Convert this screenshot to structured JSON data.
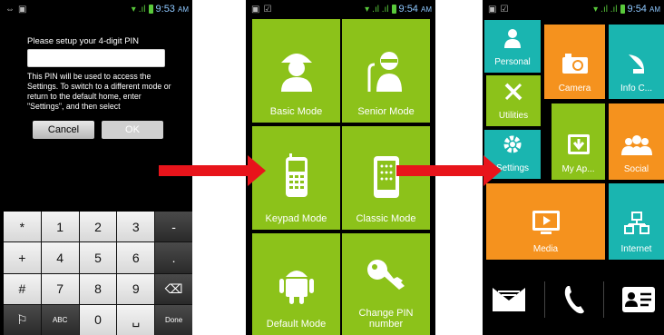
{
  "screen1": {
    "time": "9:53",
    "ampm": "AM",
    "pin_prompt": "Please setup your 4-digit PIN",
    "pin_value": "",
    "pin_description": "This PIN will be used to access the Settings. To switch to a different mode or return to the default home, enter \"Settings\", and then select",
    "cancel_label": "Cancel",
    "ok_label": "OK",
    "keys": [
      "*",
      "1",
      "2",
      "3",
      "-",
      "+",
      "4",
      "5",
      "6",
      ".",
      "#",
      "7",
      "8",
      "9",
      "⌫",
      "⚐",
      "ABC",
      "0",
      "␣",
      "Done"
    ]
  },
  "screen2": {
    "time": "9:54",
    "ampm": "AM",
    "tiles": [
      "Basic Mode",
      "Senior Mode",
      "Keypad Mode",
      "Classic Mode",
      "Default Mode",
      "Change PIN number"
    ]
  },
  "screen3": {
    "time": "9:54",
    "ampm": "AM",
    "tiles": {
      "personal": "Personal",
      "camera": "Camera",
      "info": "Info C...",
      "utilities": "Utilities",
      "myapps": "My Ap...",
      "social": "Social",
      "settings": "Settings",
      "media": "Media",
      "internet": "Internet"
    }
  },
  "colors": {
    "green": "#8cc21a",
    "teal": "#1ab5b0",
    "orange": "#f5921e",
    "arrow": "#e8141b"
  }
}
